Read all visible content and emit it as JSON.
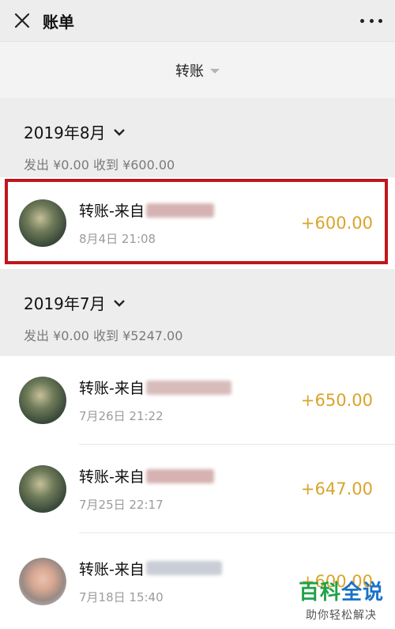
{
  "header": {
    "title": "账单",
    "close_icon": "close-icon",
    "more_icon": "more-horizontal-icon"
  },
  "filter": {
    "label": "转账"
  },
  "months": [
    {
      "title": "2019年8月",
      "summary": "发出 ¥0.00 收到 ¥600.00",
      "transactions": [
        {
          "title": "转账-来自",
          "time": "8月4日 21:08",
          "amount": "+600.00"
        }
      ]
    },
    {
      "title": "2019年7月",
      "summary": "发出 ¥0.00 收到 ¥5247.00",
      "transactions": [
        {
          "title": "转账-来自",
          "time": "7月26日 21:22",
          "amount": "+650.00"
        },
        {
          "title": "转账-来自",
          "time": "7月25日 22:17",
          "amount": "+647.00"
        },
        {
          "title": "转账-来自",
          "time": "7月18日 15:40",
          "amount": "+600.00"
        }
      ]
    }
  ],
  "colors": {
    "amount": "#d9a42b",
    "highlight": "#c0161b"
  },
  "watermark": {
    "main": "百科全说",
    "sub": "助你轻松解决"
  }
}
